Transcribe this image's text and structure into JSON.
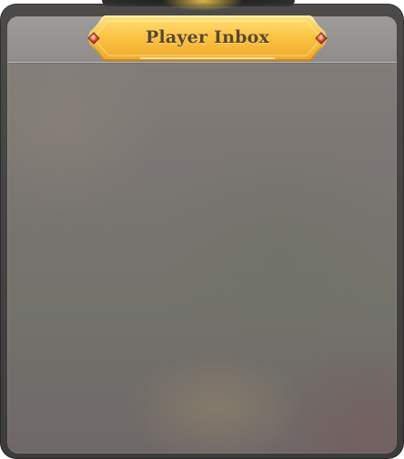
{
  "window": {
    "title": "Player Inbox"
  },
  "colors": {
    "plate_gold": "#f7b733",
    "plate_highlight": "#ffd766",
    "title_text": "#5a4630",
    "gem_red": "#d6402c",
    "frame": "#474543",
    "panel": "#7b7673"
  },
  "icons": {
    "left_gem": "ruby-gem-icon",
    "right_gem": "ruby-gem-icon"
  }
}
